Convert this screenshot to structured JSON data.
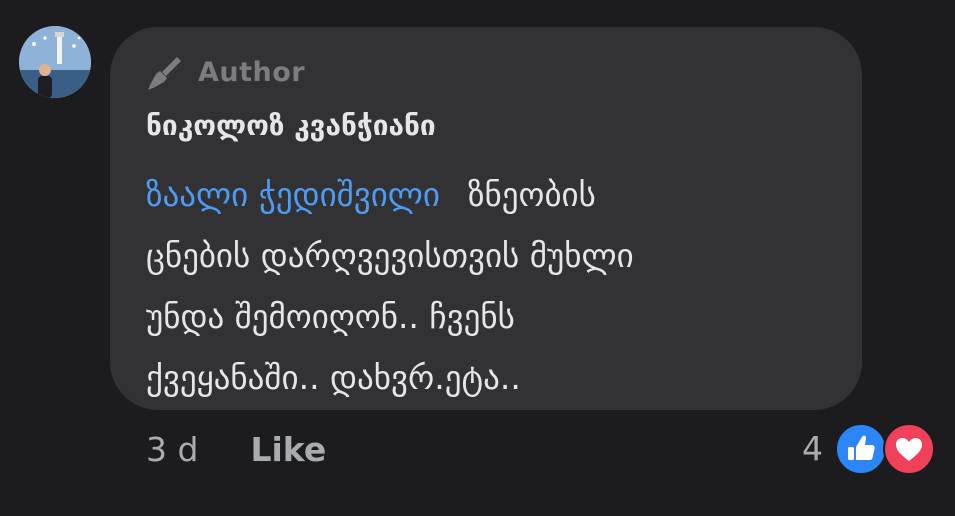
{
  "comment": {
    "badge_label": "Author",
    "author_name": "ნიკოლოზ კვანჭიანი",
    "mention": "ზაალი ჭედიშვილი",
    "text_lines": [
      "ზნეობის",
      "ცნების დარღვევისთვის მუხლი",
      "უნდა შემოიღონ.. ჩვენს",
      "ქვეყანაში.. დახვრ.ეტა.."
    ]
  },
  "meta": {
    "time": "3 d",
    "like_label": "Like",
    "reaction_count": "4"
  },
  "icons": {
    "badge": "pen-icon",
    "like_reaction": "thumbs-up-icon",
    "love_reaction": "heart-icon"
  },
  "colors": {
    "background": "#1c1c1e",
    "bubble": "#323234",
    "mention": "#4e9bf5",
    "like_reaction": "#2d86f7",
    "love_reaction": "#f0405a"
  }
}
